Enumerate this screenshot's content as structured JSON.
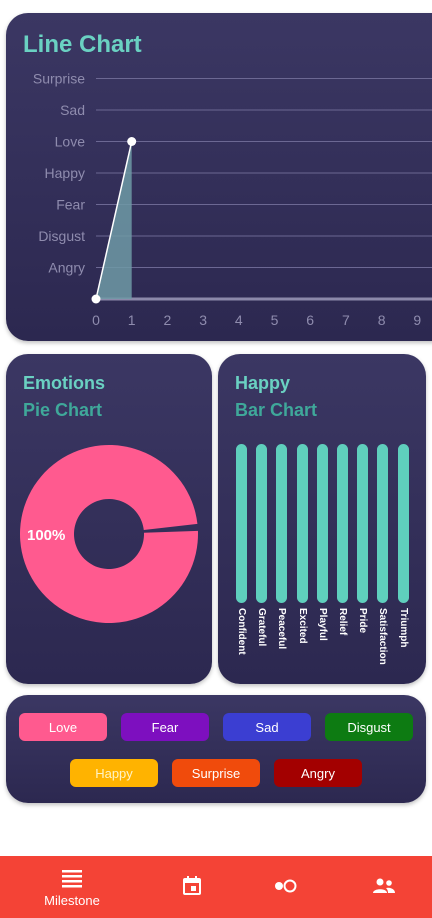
{
  "line_card": {
    "title": "Line Chart",
    "chart_data": {
      "type": "area",
      "title": "Line Chart",
      "y_categories": [
        "Angry",
        "Disgust",
        "Fear",
        "Happy",
        "Love",
        "Sad",
        "Surprise"
      ],
      "x_ticks": [
        "0",
        "1",
        "2",
        "3",
        "4",
        "5",
        "6",
        "7",
        "8",
        "9"
      ],
      "points": [
        {
          "x": 0,
          "y": "baseline"
        },
        {
          "x": 1,
          "y": "Love"
        }
      ],
      "grid": true,
      "colors": {
        "line": "#ffffff",
        "fill": "#6e9aa6",
        "grid": "#6c6893",
        "label": "#8f8cae"
      }
    }
  },
  "pie_card": {
    "title": "Emotions",
    "subtitle": "Pie Chart",
    "chart_data": {
      "type": "pie",
      "slices": [
        {
          "label": "Love",
          "value": 100,
          "color": "#ff5a8f"
        }
      ],
      "value_label": "100%"
    }
  },
  "bar_card": {
    "title": "Happy",
    "subtitle": "Bar Chart",
    "chart_data": {
      "type": "bar",
      "categories": [
        "Confident",
        "Grateful",
        "Peaceful",
        "Excited",
        "Playful",
        "Relief",
        "Pride",
        "Satisfaction",
        "Triumph"
      ],
      "values": [
        1,
        1,
        1,
        1,
        1,
        1,
        1,
        1,
        1
      ],
      "color": "#5fcfbd"
    }
  },
  "legend": {
    "items": [
      {
        "label": "Love",
        "color": "#ff5a8f",
        "text_color": "#ffffff"
      },
      {
        "label": "Fear",
        "color": "#7d0fbf",
        "text_color": "#ffffff"
      },
      {
        "label": "Sad",
        "color": "#3b3ed2",
        "text_color": "#ffffff"
      },
      {
        "label": "Disgust",
        "color": "#0d7b12",
        "text_color": "#ffffff"
      },
      {
        "label": "Happy",
        "color": "#ffb300",
        "text_color": "#fff3c4"
      },
      {
        "label": "Surprise",
        "color": "#f04b0c",
        "text_color": "#ffffff"
      },
      {
        "label": "Angry",
        "color": "#a30000",
        "text_color": "#ffffff"
      }
    ]
  },
  "bottom_nav": {
    "background": "#f44336",
    "items": [
      {
        "icon": "milestone-icon",
        "label": "Milestone"
      },
      {
        "icon": "calendar-icon",
        "label": ""
      },
      {
        "icon": "toggle-icon",
        "label": ""
      },
      {
        "icon": "people-icon",
        "label": ""
      }
    ]
  }
}
